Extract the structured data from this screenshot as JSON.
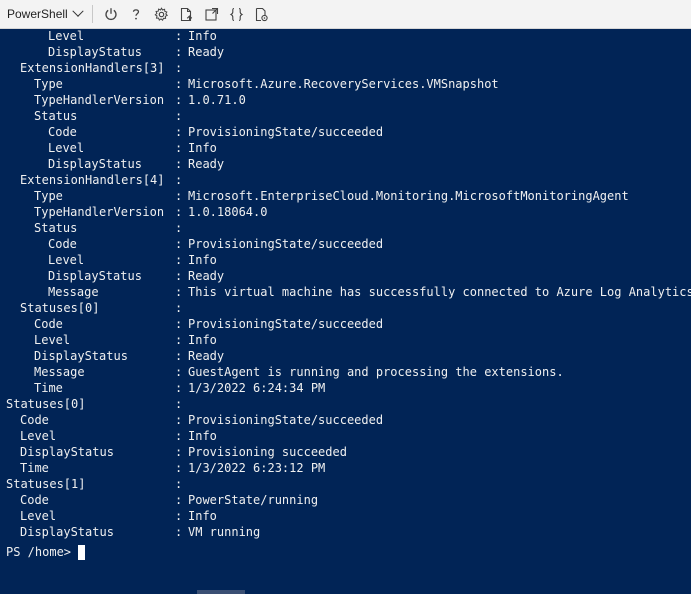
{
  "toolbar": {
    "shell": "PowerShell",
    "icons": [
      "power-icon",
      "help-icon",
      "settings-icon",
      "upload-icon",
      "open-new-session-icon",
      "editor-braces-icon",
      "web-preview-icon"
    ]
  },
  "terminal": {
    "lines": [
      {
        "indent": 3,
        "key": "Level",
        "colon": ":",
        "value": "Info"
      },
      {
        "indent": 3,
        "key": "DisplayStatus",
        "colon": ":",
        "value": "Ready"
      },
      {
        "indent": 1,
        "key": "ExtensionHandlers[3]",
        "colon": ":",
        "value": ""
      },
      {
        "indent": 2,
        "key": "Type",
        "colon": ":",
        "value": "Microsoft.Azure.RecoveryServices.VMSnapshot"
      },
      {
        "indent": 2,
        "key": "TypeHandlerVersion",
        "colon": ":",
        "value": "1.0.71.0"
      },
      {
        "indent": 2,
        "key": "Status",
        "colon": ":",
        "value": ""
      },
      {
        "indent": 3,
        "key": "Code",
        "colon": ":",
        "value": "ProvisioningState/succeeded"
      },
      {
        "indent": 3,
        "key": "Level",
        "colon": ":",
        "value": "Info"
      },
      {
        "indent": 3,
        "key": "DisplayStatus",
        "colon": ":",
        "value": "Ready"
      },
      {
        "indent": 1,
        "key": "ExtensionHandlers[4]",
        "colon": ":",
        "value": ""
      },
      {
        "indent": 2,
        "key": "Type",
        "colon": ":",
        "value": "Microsoft.EnterpriseCloud.Monitoring.MicrosoftMonitoringAgent"
      },
      {
        "indent": 2,
        "key": "TypeHandlerVersion",
        "colon": ":",
        "value": "1.0.18064.0"
      },
      {
        "indent": 2,
        "key": "Status",
        "colon": ":",
        "value": ""
      },
      {
        "indent": 3,
        "key": "Code",
        "colon": ":",
        "value": "ProvisioningState/succeeded"
      },
      {
        "indent": 3,
        "key": "Level",
        "colon": ":",
        "value": "Info"
      },
      {
        "indent": 3,
        "key": "DisplayStatus",
        "colon": ":",
        "value": "Ready"
      },
      {
        "indent": 3,
        "key": "Message",
        "colon": ":",
        "value": "This virtual machine has successfully connected to Azure Log Analytics."
      },
      {
        "indent": 1,
        "key": "Statuses[0]",
        "colon": ":",
        "value": ""
      },
      {
        "indent": 2,
        "key": "Code",
        "colon": ":",
        "value": "ProvisioningState/succeeded"
      },
      {
        "indent": 2,
        "key": "Level",
        "colon": ":",
        "value": "Info"
      },
      {
        "indent": 2,
        "key": "DisplayStatus",
        "colon": ":",
        "value": "Ready"
      },
      {
        "indent": 2,
        "key": "Message",
        "colon": ":",
        "value": "GuestAgent is running and processing the extensions."
      },
      {
        "indent": 2,
        "key": "Time",
        "colon": ":",
        "value": "1/3/2022 6:24:34 PM"
      },
      {
        "indent": 0,
        "key": "Statuses[0]",
        "colon": ":",
        "value": ""
      },
      {
        "indent": 1,
        "key": "Code",
        "colon": ":",
        "value": "ProvisioningState/succeeded"
      },
      {
        "indent": 1,
        "key": "Level",
        "colon": ":",
        "value": "Info"
      },
      {
        "indent": 1,
        "key": "DisplayStatus",
        "colon": ":",
        "value": "Provisioning succeeded"
      },
      {
        "indent": 1,
        "key": "Time",
        "colon": ":",
        "value": "1/3/2022 6:23:12 PM"
      },
      {
        "indent": 0,
        "key": "Statuses[1]",
        "colon": ":",
        "value": ""
      },
      {
        "indent": 1,
        "key": "Code",
        "colon": ":",
        "value": "PowerState/running"
      },
      {
        "indent": 1,
        "key": "Level",
        "colon": ":",
        "value": "Info"
      },
      {
        "indent": 1,
        "key": "DisplayStatus",
        "colon": ":",
        "value": "VM running"
      }
    ],
    "prompt": "PS /home>"
  },
  "colors": {
    "background": "#012456",
    "text": "#f0f0f0",
    "toolbar": "#f3f3f3"
  }
}
